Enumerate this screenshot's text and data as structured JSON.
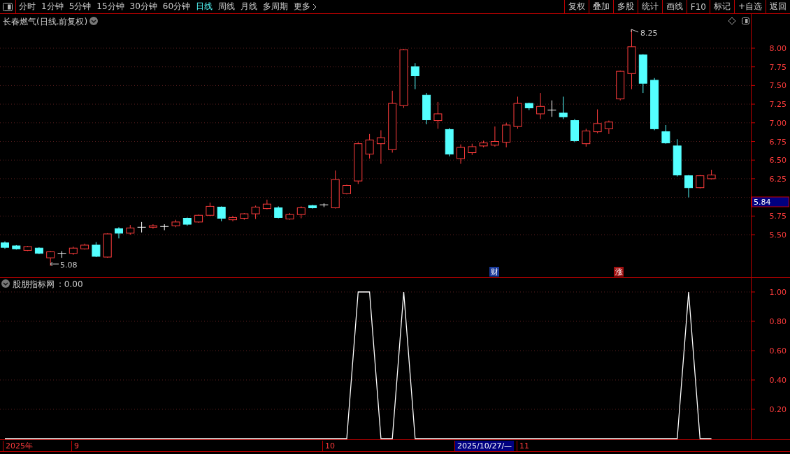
{
  "toolbar": {
    "periods": [
      {
        "label": "分时",
        "selected": false
      },
      {
        "label": "1分钟",
        "selected": false
      },
      {
        "label": "5分钟",
        "selected": false
      },
      {
        "label": "15分钟",
        "selected": false
      },
      {
        "label": "30分钟",
        "selected": false
      },
      {
        "label": "60分钟",
        "selected": false
      },
      {
        "label": "日线",
        "selected": true
      },
      {
        "label": "周线",
        "selected": false
      },
      {
        "label": "月线",
        "selected": false
      },
      {
        "label": "多周期",
        "selected": false
      },
      {
        "label": "更多",
        "selected": false
      }
    ],
    "actions": [
      "复权",
      "叠加",
      "多股",
      "统计",
      "画线",
      "F10",
      "标记",
      "+自选",
      "返回"
    ]
  },
  "main_chart": {
    "title": "长春燃气(日线.前复权)",
    "high_label": "8.25",
    "low_label": "5.08",
    "price_axis": [
      "8.00",
      "7.75",
      "7.50",
      "7.25",
      "7.00",
      "6.75",
      "6.50",
      "6.25",
      "5.75",
      "5.50"
    ],
    "current_price": "5.84",
    "markers": [
      {
        "text": "财",
        "kind": "finance"
      },
      {
        "text": "涨",
        "kind": "rise"
      }
    ]
  },
  "indicator": {
    "reading": ": 0.00",
    "chart_data": {
      "type": "line",
      "series": [
        {
          "name": "股朋指标网",
          "color": "#ffffff",
          "values": [
            0,
            0,
            0,
            0,
            0,
            0,
            0,
            0,
            0,
            0,
            0,
            0,
            0,
            0,
            0,
            0,
            0,
            0,
            0,
            0,
            0,
            0,
            0,
            0,
            0,
            0,
            0,
            0,
            0,
            0,
            0,
            1,
            1,
            0,
            0,
            1,
            0,
            0,
            0,
            0,
            0,
            0,
            0,
            0,
            0,
            0,
            0,
            0,
            0,
            0,
            0,
            0,
            0,
            0,
            0,
            0,
            0,
            0,
            0,
            0,
            1,
            0,
            0
          ]
        }
      ],
      "ylim": [
        0,
        1
      ],
      "grid": true,
      "yticks": [
        {
          "value": 1,
          "label": "1.00"
        },
        {
          "value": 0.8,
          "label": "0.80"
        },
        {
          "value": 0.6,
          "label": "0.60"
        },
        {
          "value": 0.4,
          "label": "0.40"
        },
        {
          "value": 0.2,
          "label": "0.20"
        }
      ]
    }
  },
  "date_bar": {
    "labels": [
      {
        "text": "2025年",
        "selected": false
      },
      {
        "text": "9",
        "selected": false
      },
      {
        "text": "10",
        "selected": false
      },
      {
        "text": "2025/10/27/—",
        "selected": true
      },
      {
        "text": "11",
        "selected": false
      }
    ]
  }
}
